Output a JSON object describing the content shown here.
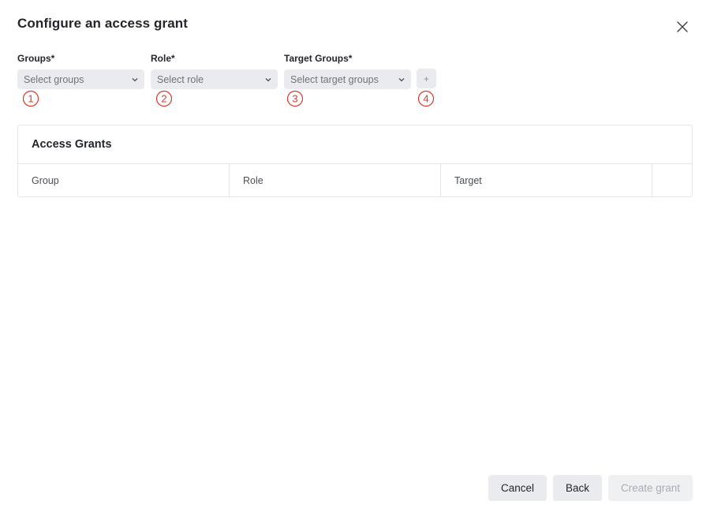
{
  "dialog": {
    "title": "Configure an access grant",
    "close_icon": "close-icon"
  },
  "form": {
    "groups": {
      "label": "Groups*",
      "placeholder": "Select groups",
      "marker": "①"
    },
    "role": {
      "label": "Role*",
      "placeholder": "Select role",
      "marker": "②"
    },
    "target_groups": {
      "label": "Target Groups*",
      "placeholder": "Select target groups",
      "marker": "③"
    },
    "add": {
      "label": "+",
      "marker": "④"
    }
  },
  "grants": {
    "title": "Access Grants",
    "columns": [
      "Group",
      "Role",
      "Target",
      ""
    ]
  },
  "footer": {
    "cancel_label": "Cancel",
    "back_label": "Back",
    "create_label": "Create grant"
  },
  "colors": {
    "marker": "#d93a2b",
    "control_bg": "#e9ebee",
    "disabled_text": "#a9adb3"
  }
}
